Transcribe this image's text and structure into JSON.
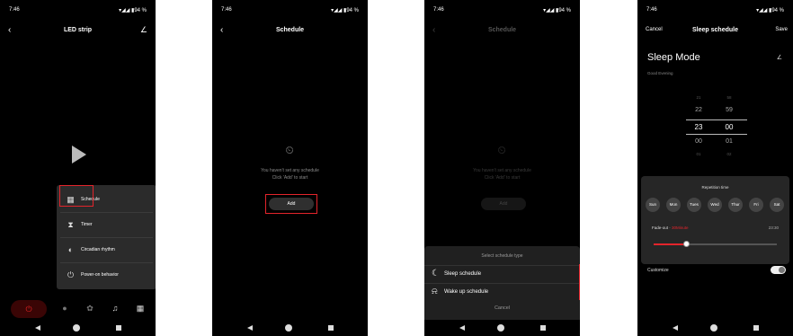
{
  "status": {
    "time": "7:46",
    "icons": "▾◢◢ ▮94 %"
  },
  "screen1": {
    "title": "LED strip",
    "menu": [
      {
        "label": "Schedule",
        "icon": "schedule-icon"
      },
      {
        "label": "Timer",
        "icon": "hourglass-icon"
      },
      {
        "label": "Circadian rhythm",
        "icon": "circadian-icon"
      },
      {
        "label": "Power-on behavior",
        "icon": "power-on-icon"
      }
    ]
  },
  "screen2": {
    "title": "Schedule",
    "empty_line1": "You haven't set any schedule",
    "empty_line2": "Click 'Add' to start",
    "add_label": "Add"
  },
  "screen3": {
    "title": "Schedule",
    "sheet_title": "Select schedule type",
    "options": [
      {
        "label": "Sleep schedule",
        "icon": "moon-icon"
      },
      {
        "label": "Wake up schedule",
        "icon": "bell-icon"
      }
    ],
    "cancel_label": "Cancel"
  },
  "screen4": {
    "cancel": "Cancel",
    "title": "Sleep schedule",
    "save": "Save",
    "mode_title": "Sleep Mode",
    "greeting": "Good Evening",
    "hours": [
      "21",
      "22",
      "23",
      "00",
      "01"
    ],
    "minutes": [
      "58",
      "59",
      "00",
      "01",
      "02"
    ],
    "repetition_title": "Repetition time",
    "days": [
      "Sun",
      "Mon",
      "Tues",
      "Wed",
      "Thur",
      "Fri",
      "Sat"
    ],
    "fade_prefix": "Fade-out · ",
    "fade_value": "30Minute",
    "fade_time": "23:30",
    "fade_fraction": 0.27,
    "customize": "Customize",
    "customize_on": true
  },
  "colors": {
    "accent": "#e3242b",
    "background": "#000000"
  }
}
